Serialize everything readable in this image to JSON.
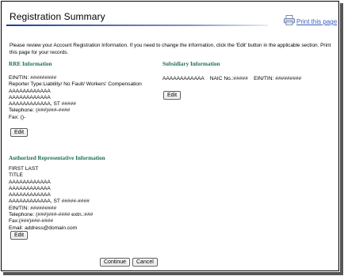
{
  "header": {
    "title": "Registration Summary",
    "print_label": "Print this page"
  },
  "intro": "Please review your Account Registration Information. If you need to change the information, click the 'Edit' button in the applicable section. Print this page for your records.",
  "rre": {
    "heading": "RRE Information",
    "ein": "EIN/TIN: #########",
    "reporter_type": "Reporter Type:Liability/ No Fault/ Workers' Compensation",
    "name1": "AAAAAAAAAAAA",
    "name2": "AAAAAAAAAAAA",
    "city_state": "AAAAAAAAAAAA, ST #####",
    "telephone": "Telephone: (###)###-####",
    "fax": "Fax: ()-",
    "edit_label": "Edit"
  },
  "subsidiary": {
    "heading": "Subsidiary Information",
    "line": "AAAAAAAAAAAA    NAIC No.:#####    EIN/TIN: #########",
    "edit_label": "Edit"
  },
  "authorized": {
    "heading": "Authorized Representative Information",
    "name": "FIRST LAST",
    "title": "TITLE",
    "line1": "AAAAAAAAAAAA",
    "line2": "AAAAAAAAAAAA",
    "line3": "AAAAAAAAAAAA",
    "city_state": "AAAAAAAAAAAA, ST  #####-####",
    "ein": "EIN/TIN: #########",
    "telephone": "Telephone: (###)###-#### extn.:###",
    "fax": "Fax:(###)###-####",
    "email": "Email: address@domain.com",
    "edit_label": "Edit"
  },
  "actions": {
    "continue_label": "Continue",
    "cancel_label": "Cancel"
  },
  "colors": {
    "section_heading": "#1e6e5a",
    "link": "#3b5bbd",
    "title_rule": "#1f3f8f"
  }
}
